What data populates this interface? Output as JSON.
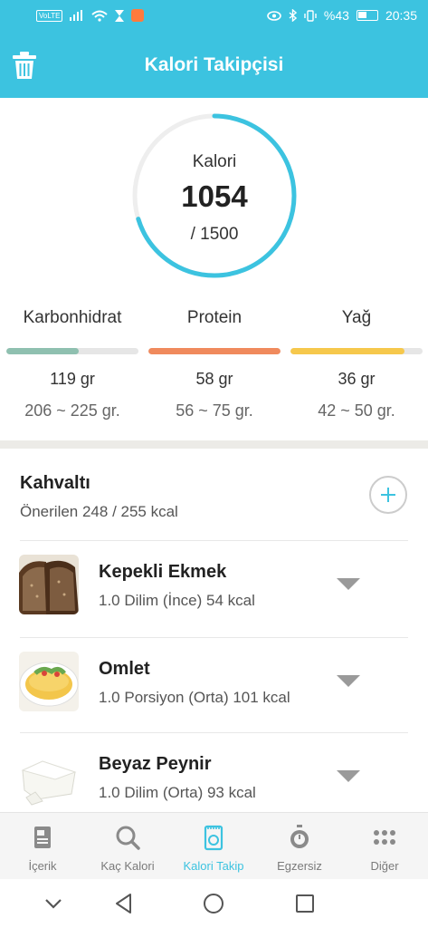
{
  "status_bar": {
    "network_badge": "VoLTE",
    "battery": "%43",
    "time": "20:35"
  },
  "header": {
    "title": "Kalori Takipçisi",
    "trash_icon": "trash-icon"
  },
  "calorie_ring": {
    "label": "Kalori",
    "value": "1054",
    "goal": "/ 1500",
    "progress": 0.7027,
    "color": "#3cc3e0",
    "track_color": "#eeeeee"
  },
  "macros": [
    {
      "name": "Karbonhidrat",
      "amount": "119 gr",
      "range": "206 ~ 225 gr.",
      "progress": 0.55,
      "color": "#8fc0b0"
    },
    {
      "name": "Protein",
      "amount": "58 gr",
      "range": "56 ~ 75 gr.",
      "progress": 1.0,
      "color": "#f08a5d"
    },
    {
      "name": "Yağ",
      "amount": "36 gr",
      "range": "42 ~ 50 gr.",
      "progress": 0.86,
      "color": "#f6c84c"
    }
  ],
  "meal": {
    "title": "Kahvaltı",
    "subtitle": "Önerilen 248 / 255 kcal",
    "add_icon": "plus-icon"
  },
  "foods": [
    {
      "name": "Kepekli Ekmek",
      "detail": "1.0 Dilim (İnce) 54 kcal",
      "thumb": "bread"
    },
    {
      "name": "Omlet",
      "detail": "1.0 Porsiyon (Orta) 101 kcal",
      "thumb": "omelette"
    },
    {
      "name": "Beyaz Peynir",
      "detail": "1.0 Dilim (Orta) 93 kcal",
      "thumb": "cheese"
    }
  ],
  "bottom_nav": [
    {
      "label": "İçerik",
      "icon": "content-icon",
      "active": false
    },
    {
      "label": "Kaç Kalori",
      "icon": "search-icon",
      "active": false
    },
    {
      "label": "Kalori Takip",
      "icon": "tracker-icon",
      "active": true
    },
    {
      "label": "Egzersiz",
      "icon": "stopwatch-icon",
      "active": false
    },
    {
      "label": "Diğer",
      "icon": "more-icon",
      "active": false
    }
  ],
  "system_nav": [
    "chevron-down-icon",
    "back-icon",
    "home-icon",
    "recents-icon"
  ]
}
